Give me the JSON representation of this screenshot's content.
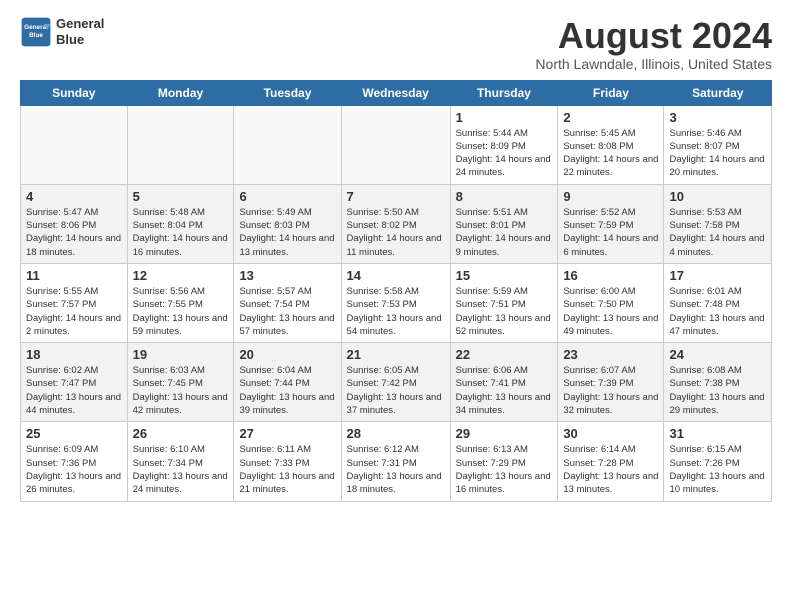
{
  "header": {
    "logo_line1": "General",
    "logo_line2": "Blue",
    "month": "August 2024",
    "location": "North Lawndale, Illinois, United States"
  },
  "days_of_week": [
    "Sunday",
    "Monday",
    "Tuesday",
    "Wednesday",
    "Thursday",
    "Friday",
    "Saturday"
  ],
  "weeks": [
    [
      {
        "day": "",
        "empty": true
      },
      {
        "day": "",
        "empty": true
      },
      {
        "day": "",
        "empty": true
      },
      {
        "day": "",
        "empty": true
      },
      {
        "day": "1",
        "sunrise": "5:44 AM",
        "sunset": "8:09 PM",
        "daylight": "14 hours and 24 minutes."
      },
      {
        "day": "2",
        "sunrise": "5:45 AM",
        "sunset": "8:08 PM",
        "daylight": "14 hours and 22 minutes."
      },
      {
        "day": "3",
        "sunrise": "5:46 AM",
        "sunset": "8:07 PM",
        "daylight": "14 hours and 20 minutes."
      }
    ],
    [
      {
        "day": "4",
        "sunrise": "5:47 AM",
        "sunset": "8:06 PM",
        "daylight": "14 hours and 18 minutes."
      },
      {
        "day": "5",
        "sunrise": "5:48 AM",
        "sunset": "8:04 PM",
        "daylight": "14 hours and 16 minutes."
      },
      {
        "day": "6",
        "sunrise": "5:49 AM",
        "sunset": "8:03 PM",
        "daylight": "14 hours and 13 minutes."
      },
      {
        "day": "7",
        "sunrise": "5:50 AM",
        "sunset": "8:02 PM",
        "daylight": "14 hours and 11 minutes."
      },
      {
        "day": "8",
        "sunrise": "5:51 AM",
        "sunset": "8:01 PM",
        "daylight": "14 hours and 9 minutes."
      },
      {
        "day": "9",
        "sunrise": "5:52 AM",
        "sunset": "7:59 PM",
        "daylight": "14 hours and 6 minutes."
      },
      {
        "day": "10",
        "sunrise": "5:53 AM",
        "sunset": "7:58 PM",
        "daylight": "14 hours and 4 minutes."
      }
    ],
    [
      {
        "day": "11",
        "sunrise": "5:55 AM",
        "sunset": "7:57 PM",
        "daylight": "14 hours and 2 minutes."
      },
      {
        "day": "12",
        "sunrise": "5:56 AM",
        "sunset": "7:55 PM",
        "daylight": "13 hours and 59 minutes."
      },
      {
        "day": "13",
        "sunrise": "5:57 AM",
        "sunset": "7:54 PM",
        "daylight": "13 hours and 57 minutes."
      },
      {
        "day": "14",
        "sunrise": "5:58 AM",
        "sunset": "7:53 PM",
        "daylight": "13 hours and 54 minutes."
      },
      {
        "day": "15",
        "sunrise": "5:59 AM",
        "sunset": "7:51 PM",
        "daylight": "13 hours and 52 minutes."
      },
      {
        "day": "16",
        "sunrise": "6:00 AM",
        "sunset": "7:50 PM",
        "daylight": "13 hours and 49 minutes."
      },
      {
        "day": "17",
        "sunrise": "6:01 AM",
        "sunset": "7:48 PM",
        "daylight": "13 hours and 47 minutes."
      }
    ],
    [
      {
        "day": "18",
        "sunrise": "6:02 AM",
        "sunset": "7:47 PM",
        "daylight": "13 hours and 44 minutes."
      },
      {
        "day": "19",
        "sunrise": "6:03 AM",
        "sunset": "7:45 PM",
        "daylight": "13 hours and 42 minutes."
      },
      {
        "day": "20",
        "sunrise": "6:04 AM",
        "sunset": "7:44 PM",
        "daylight": "13 hours and 39 minutes."
      },
      {
        "day": "21",
        "sunrise": "6:05 AM",
        "sunset": "7:42 PM",
        "daylight": "13 hours and 37 minutes."
      },
      {
        "day": "22",
        "sunrise": "6:06 AM",
        "sunset": "7:41 PM",
        "daylight": "13 hours and 34 minutes."
      },
      {
        "day": "23",
        "sunrise": "6:07 AM",
        "sunset": "7:39 PM",
        "daylight": "13 hours and 32 minutes."
      },
      {
        "day": "24",
        "sunrise": "6:08 AM",
        "sunset": "7:38 PM",
        "daylight": "13 hours and 29 minutes."
      }
    ],
    [
      {
        "day": "25",
        "sunrise": "6:09 AM",
        "sunset": "7:36 PM",
        "daylight": "13 hours and 26 minutes."
      },
      {
        "day": "26",
        "sunrise": "6:10 AM",
        "sunset": "7:34 PM",
        "daylight": "13 hours and 24 minutes."
      },
      {
        "day": "27",
        "sunrise": "6:11 AM",
        "sunset": "7:33 PM",
        "daylight": "13 hours and 21 minutes."
      },
      {
        "day": "28",
        "sunrise": "6:12 AM",
        "sunset": "7:31 PM",
        "daylight": "13 hours and 18 minutes."
      },
      {
        "day": "29",
        "sunrise": "6:13 AM",
        "sunset": "7:29 PM",
        "daylight": "13 hours and 16 minutes."
      },
      {
        "day": "30",
        "sunrise": "6:14 AM",
        "sunset": "7:28 PM",
        "daylight": "13 hours and 13 minutes."
      },
      {
        "day": "31",
        "sunrise": "6:15 AM",
        "sunset": "7:26 PM",
        "daylight": "13 hours and 10 minutes."
      }
    ]
  ]
}
